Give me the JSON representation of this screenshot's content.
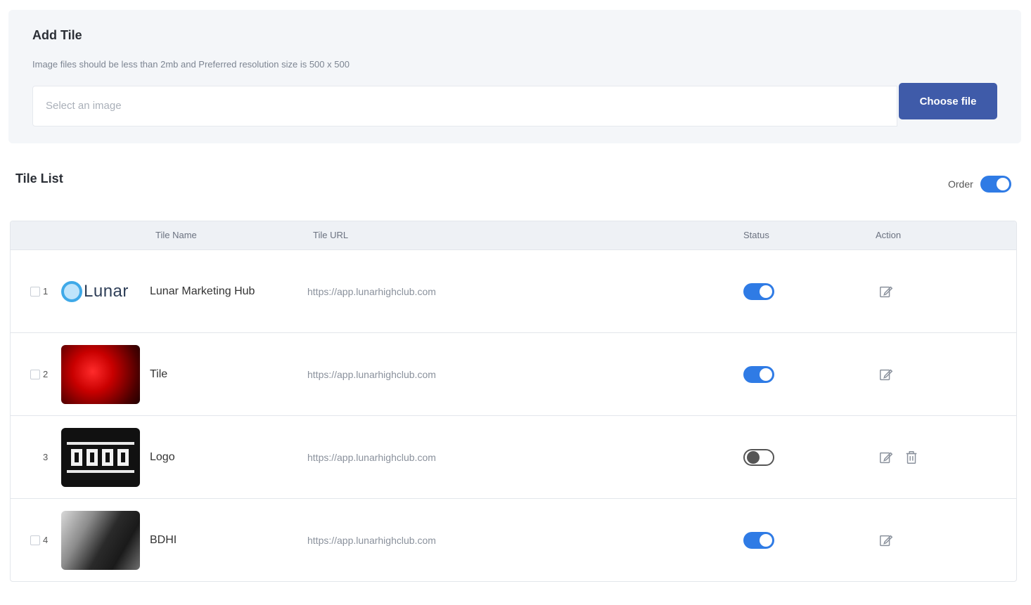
{
  "add_tile": {
    "title": "Add Tile",
    "hint": "Image files should be less than 2mb and Preferred resolution size is 500 x 500",
    "input_placeholder": "Select an image",
    "choose_button": "Choose file"
  },
  "tile_list": {
    "title": "Tile List",
    "order_label": "Order",
    "order_enabled": true,
    "columns": [
      "Tile Name",
      "Tile URL",
      "Status",
      "Action"
    ],
    "rows": [
      {
        "index": "1",
        "name": "Lunar Marketing Hub",
        "url": "https://app.lunarhighclub.com",
        "status": "on",
        "thumb_icon": "lunar-logo",
        "thumb_text": "Lunar"
      },
      {
        "index": "2",
        "name": "Tile",
        "url": "https://app.lunarhighclub.com",
        "status": "on",
        "thumb_icon": "red-abstract-image",
        "thumb_text": ""
      },
      {
        "index": "3",
        "name": "Logo",
        "url": "https://app.lunarhighclub.com",
        "status": "off",
        "thumb_icon": "black-logo-image",
        "thumb_text": ""
      },
      {
        "index": "4",
        "name": "BDHI",
        "url": "https://app.lunarhighclub.com",
        "status": "on",
        "thumb_icon": "photo-image",
        "thumb_text": ""
      }
    ]
  },
  "colors": {
    "primary": "#3f5ba9",
    "toggle_on": "#2f7be5",
    "panel_bg": "#f4f6f9",
    "header_bg": "#eef1f5"
  }
}
